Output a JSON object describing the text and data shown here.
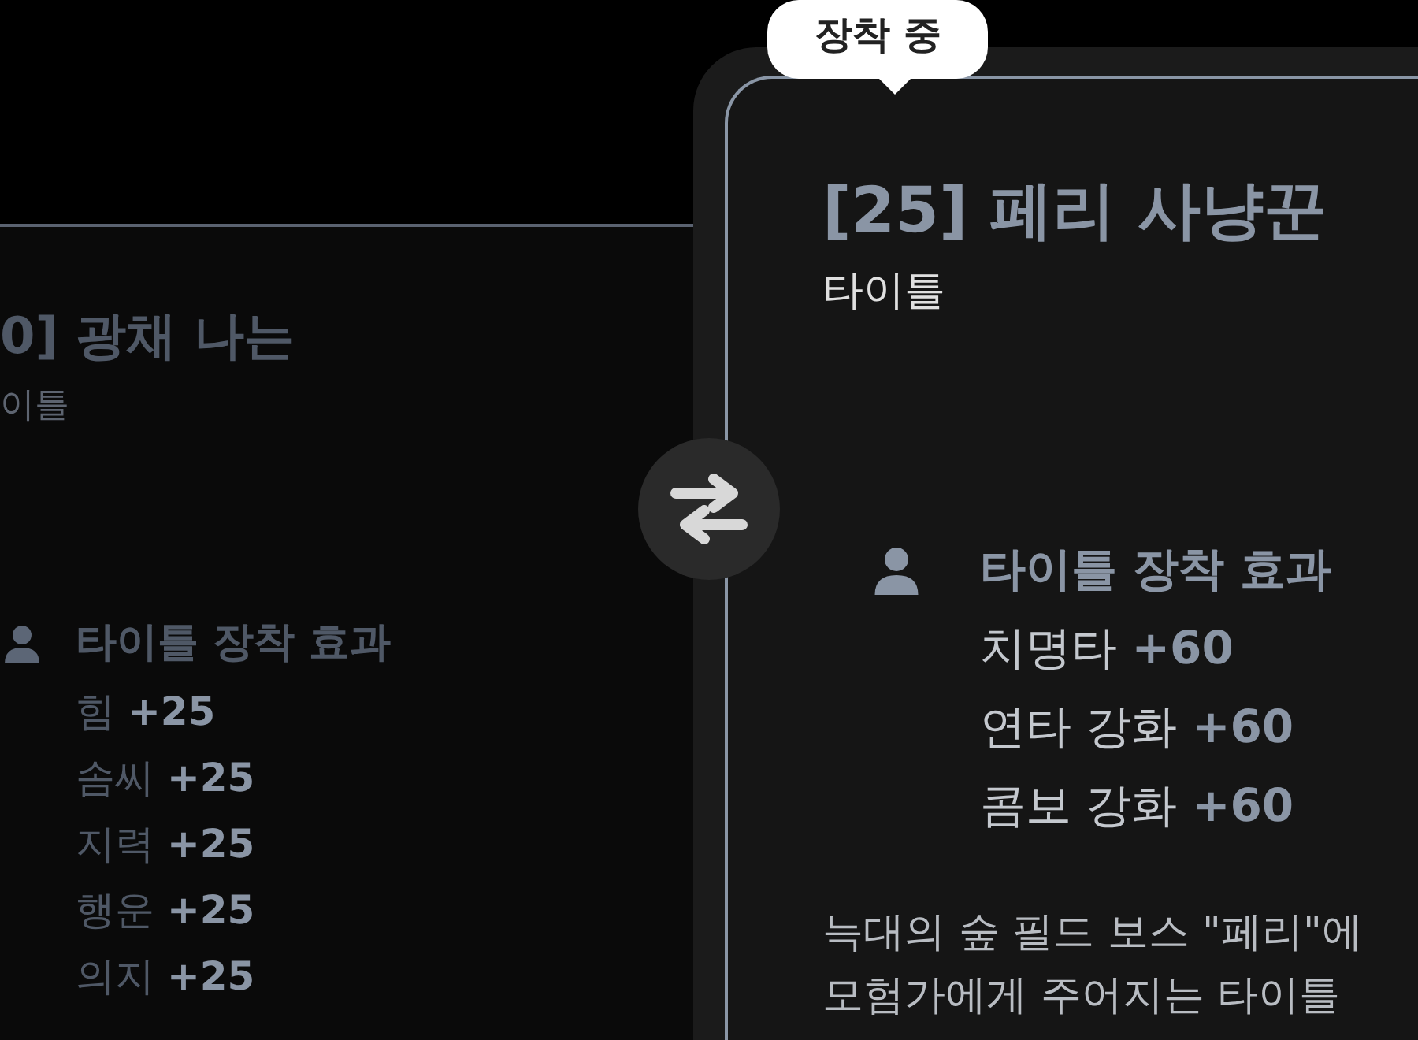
{
  "left_card": {
    "title": "0] 광채 나는",
    "category": "이틀",
    "effects_heading": "타이틀 장착 효과",
    "effects": [
      "힘 **+25**",
      "솜씨 **+25**",
      "지력 **+25**",
      "행운 **+25**",
      "의지 **+25**"
    ]
  },
  "right_card": {
    "badge": "장착 중",
    "title": "[25] 페리 사냥꾼",
    "category": "타이틀",
    "effects_heading": "타이틀 장착 효과",
    "effects": [
      "치명타 **+60**",
      "연타 강화 **+60**",
      "콤보 강화 **+60**"
    ],
    "description": [
      "늑대의 숲 필드 보스 \"페리\"에",
      "모험가에게 주어지는 타이틀"
    ]
  }
}
